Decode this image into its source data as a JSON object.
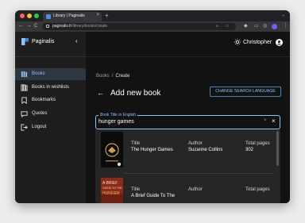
{
  "browser": {
    "tab_title": "Library | Paginalis",
    "tab_close": "×",
    "new_tab": "+",
    "tabstrip_menu": "⌄",
    "back": "←",
    "forward": "→",
    "reload": "C",
    "url_host": "paginalis.fr",
    "url_path": "/library/books/create",
    "menu": "⋮"
  },
  "sidebar": {
    "brand": "Paginalis",
    "collapse": "‹",
    "items": [
      {
        "label": "Books",
        "icon": "books-icon",
        "active": true
      },
      {
        "label": "Books in wishlists",
        "icon": "wishlist-icon",
        "active": false
      },
      {
        "label": "Bookmarks",
        "icon": "bookmark-icon",
        "active": false
      },
      {
        "label": "Quotes",
        "icon": "quotes-icon",
        "active": false
      },
      {
        "label": "Logout",
        "icon": "logout-icon",
        "active": false
      }
    ]
  },
  "header": {
    "user_name": "Christopher"
  },
  "breadcrumb": {
    "parent": "Books",
    "separator": "/",
    "current": "Create"
  },
  "page": {
    "back_arrow": "←",
    "title": "Add new book",
    "change_language_button": "CHANGE SEARCH LANGUAGE"
  },
  "search": {
    "label": "Book Title in English",
    "value": "hunger games",
    "clear": "×",
    "close": "×"
  },
  "results": {
    "columns": [
      "Title",
      "Author",
      "Total pages"
    ],
    "rows": [
      {
        "title": "The Hunger Games",
        "author": "Suzanne Collins",
        "pages": "302"
      },
      {
        "title": "A Brief Guide To The",
        "author": "",
        "pages": ""
      }
    ],
    "cover2_text": [
      "A BRIEF",
      "GUIDE TO THE",
      "HUNGER"
    ]
  },
  "colors": {
    "accent": "#8fc1ff",
    "sidebar_active": "#2e3640",
    "background": "#121212"
  }
}
